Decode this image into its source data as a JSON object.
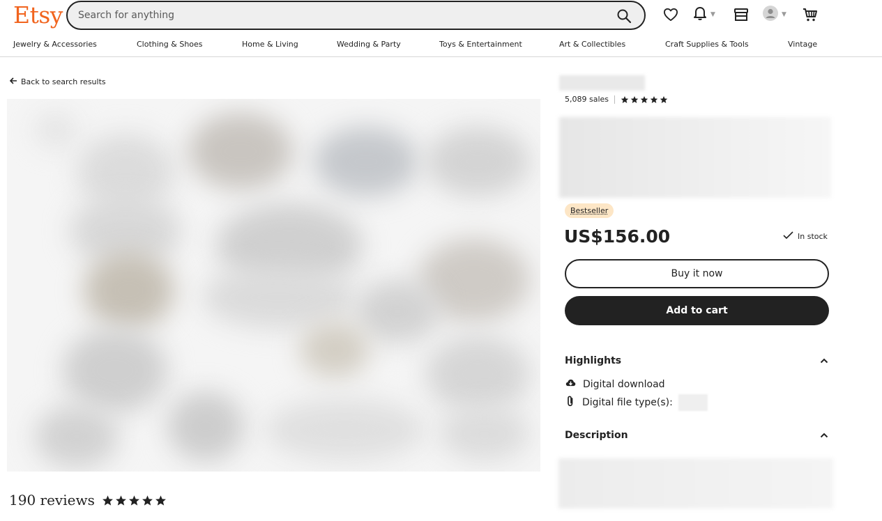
{
  "header": {
    "logo": "Etsy",
    "search_placeholder": "Search for anything",
    "icons": [
      "heart-icon",
      "bell-icon",
      "shop-icon",
      "avatar-icon",
      "cart-icon"
    ]
  },
  "categories": [
    "Jewelry & Accessories",
    "Clothing & Shoes",
    "Home & Living",
    "Wedding & Party",
    "Toys & Entertainment",
    "Art & Collectibles",
    "Craft Supplies & Tools",
    "Vintage"
  ],
  "back_link": "Back to search results",
  "reviews": {
    "label": "190 reviews",
    "rating": 5
  },
  "product": {
    "sales": "5,089 sales",
    "shop_rating": 5,
    "badge": "Bestseller",
    "price": "US$156.00",
    "stock": "In stock",
    "buy_now": "Buy it now",
    "add_to_cart": "Add to cart"
  },
  "highlights": {
    "title": "Highlights",
    "items": [
      {
        "icon": "cloud-download-icon",
        "text": "Digital download"
      },
      {
        "icon": "paperclip-icon",
        "text": "Digital file type(s):"
      }
    ]
  },
  "description": {
    "title": "Description"
  },
  "colors": {
    "brand": "#f1641e",
    "badge_bg": "#fde6c6",
    "button_dark": "#222222"
  }
}
